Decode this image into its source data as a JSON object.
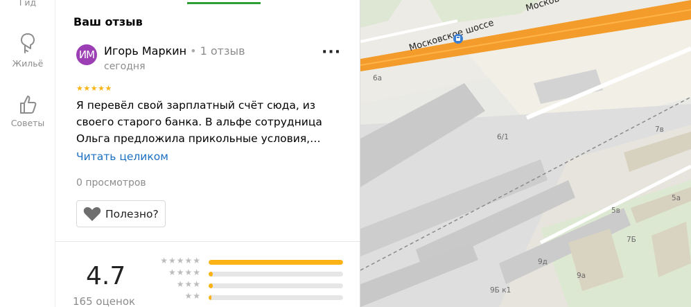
{
  "nav": {
    "top_partial_label": "Гид",
    "items": [
      {
        "label": "Жильё",
        "icon": "home-icon"
      },
      {
        "label": "Советы",
        "icon": "thumbs-up-icon"
      }
    ]
  },
  "review": {
    "section_title": "Ваш отзыв",
    "avatar_initials": "ИМ",
    "avatar_color": "#9c3fb5",
    "author_name": "Игорь Маркин",
    "author_dot": "•",
    "author_review_count": "1 отзыв",
    "date": "сегодня",
    "more_label": "···",
    "stars": "★★★★★",
    "star_color": "#fcb316",
    "text": "Я перевёл свой зарплатный счёт сюда, из своего старого банка. В альфе сотрудница Ольга предложила прикольные условия,…",
    "read_more": "Читать целиком",
    "views": "0 просмотров",
    "useful_label": "Полезно?"
  },
  "rating": {
    "value": "4.7",
    "count_label": "165 оценок",
    "distribution": [
      {
        "stars": "★★★★★",
        "fraction": 1.0
      },
      {
        "stars": "★★★★",
        "fraction": 0.03
      },
      {
        "stars": "★★★",
        "fraction": 0.03
      },
      {
        "stars": "★★",
        "fraction": 0.02
      }
    ]
  },
  "map": {
    "road_labels": [
      "Московское шоссе",
      "Москов"
    ],
    "house_labels": [
      "6а",
      "6/1",
      "7в",
      "5в",
      "5а",
      "7Б",
      "9д",
      "9а",
      "9Б к1"
    ],
    "bus_stop_icon": "bus-stop-icon",
    "accent_road_color": "#f39c2b"
  }
}
